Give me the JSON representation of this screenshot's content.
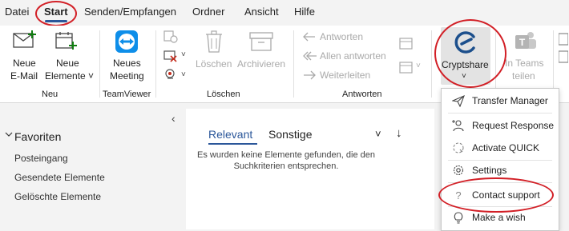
{
  "menu": {
    "tabs": [
      "Datei",
      "Start",
      "Senden/Empfangen",
      "Ordner",
      "Ansicht",
      "Hilfe"
    ]
  },
  "ribbon": {
    "new_email": [
      "Neue",
      "E-Mail"
    ],
    "new_items": [
      "Neue",
      "Elemente ˅"
    ],
    "new_meeting": [
      "Neues",
      "Meeting"
    ],
    "delete": "Löschen",
    "archive": "Archivieren",
    "reply": "Antworten",
    "reply_all": "Allen antworten",
    "forward": "Weiterleiten",
    "cryptshare": "Cryptshare",
    "cryptshare_caret": "˅",
    "teams": [
      "In Teams",
      "teilen"
    ],
    "groups": {
      "neu": "Neu",
      "teamviewer": "TeamViewer",
      "loeschen": "Löschen",
      "antworten": "Antworten"
    },
    "chevrons": {
      "c1": "˅",
      "c2": "˅",
      "c3": "˅"
    }
  },
  "sidebar": {
    "collapse": "‹",
    "favorites_header": "Favoriten",
    "folders": [
      "Posteingang",
      "Gesendete Elemente",
      "Gelöschte Elemente"
    ]
  },
  "maillist": {
    "tab_relevant": "Relevant",
    "tab_other": "Sonstige",
    "filter": "˅",
    "sort": "↓",
    "empty": [
      "Es wurden keine Elemente gefunden, die den",
      "Suchkriterien entsprechen."
    ]
  },
  "dropdown": {
    "items": [
      "Transfer Manager",
      "Request Response",
      "Activate QUICK",
      "Settings",
      "Contact support",
      "Make a wish"
    ]
  },
  "colors": {
    "accent": "#2b579a",
    "annotation": "#d21f26",
    "cryptshare_blue": "#1c4f8c"
  }
}
